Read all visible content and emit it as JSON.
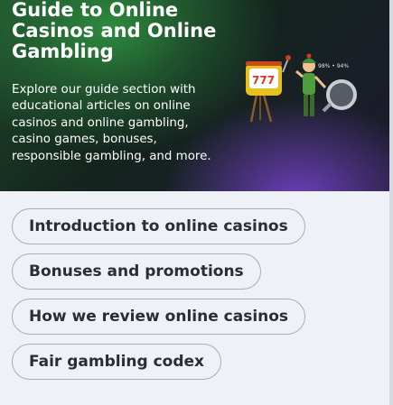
{
  "hero": {
    "title_lines": [
      "Guide to Online",
      "Casinos and Online",
      "Gambling"
    ],
    "description_lines": [
      "Explore our guide section with",
      "educational articles on online",
      "casinos and online gambling,",
      "casino games, bonuses,",
      "responsible gambling, and more."
    ],
    "illustration_text": "98% • 94%",
    "colors": {
      "accent_green": "#2d8a3e",
      "accent_purple": "#6b3fb8",
      "text": "#ffffff"
    }
  },
  "links": [
    {
      "label": "Introduction to online casinos"
    },
    {
      "label": "Bonuses and promotions"
    },
    {
      "label": "How we review online casinos"
    },
    {
      "label": "Fair gambling codex"
    }
  ]
}
